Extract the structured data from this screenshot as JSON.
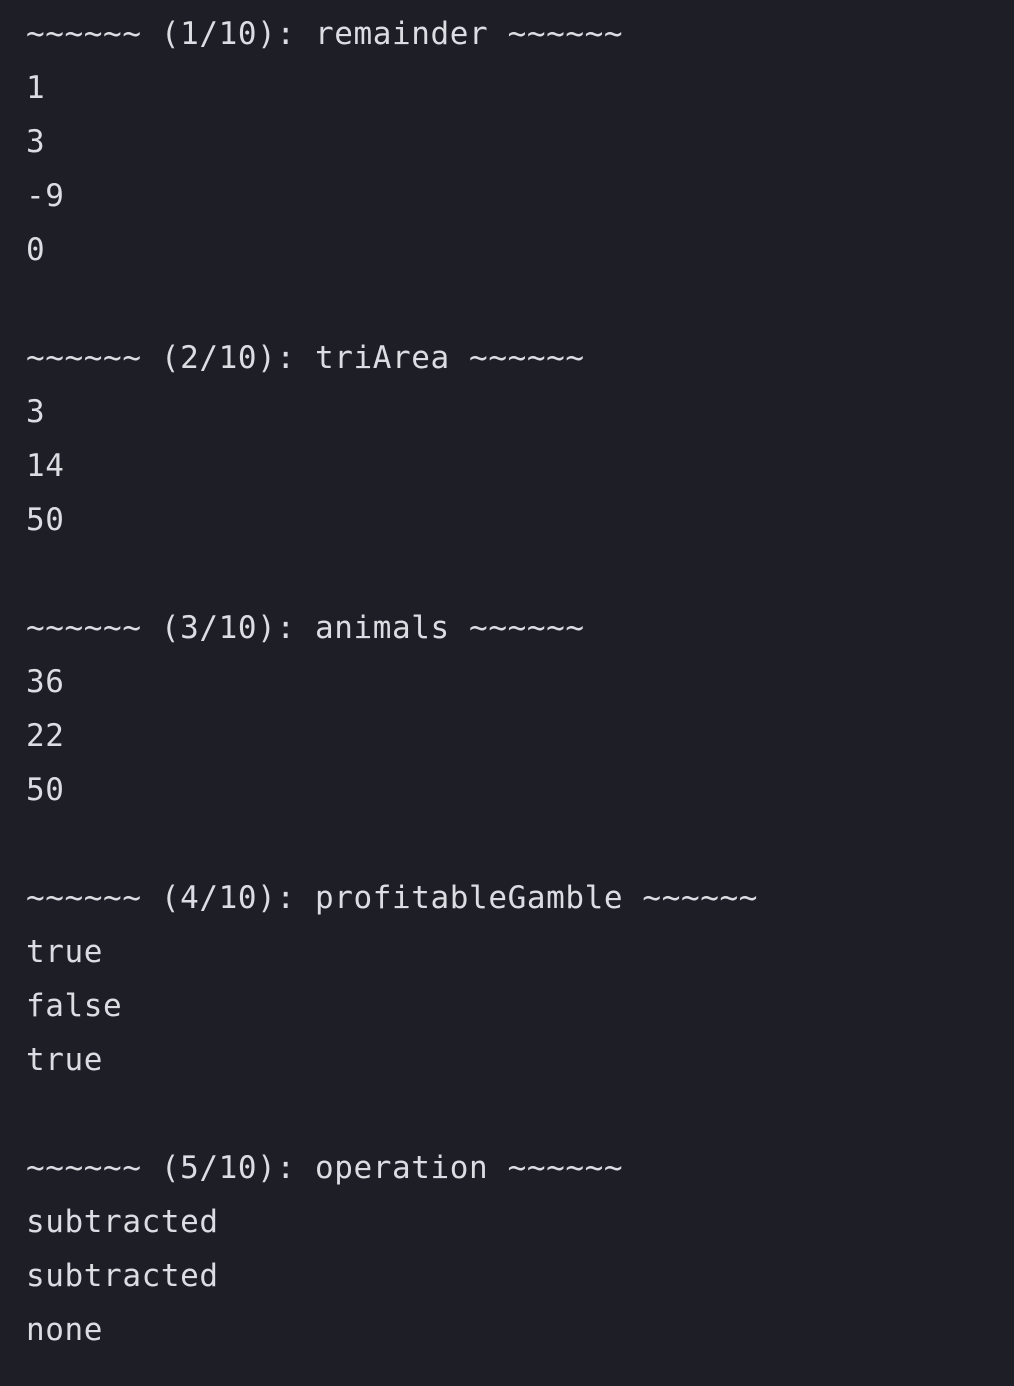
{
  "console": {
    "sections": [
      {
        "header": "~~~~~~ (1/10): remainder ~~~~~~",
        "lines": [
          "1",
          "3",
          "-9",
          "0"
        ]
      },
      {
        "header": "~~~~~~ (2/10): triArea ~~~~~~",
        "lines": [
          "3",
          "14",
          "50"
        ]
      },
      {
        "header": "~~~~~~ (3/10): animals ~~~~~~",
        "lines": [
          "36",
          "22",
          "50"
        ]
      },
      {
        "header": "~~~~~~ (4/10): profitableGamble ~~~~~~",
        "lines": [
          "true",
          "false",
          "true"
        ]
      },
      {
        "header": "~~~~~~ (5/10): operation ~~~~~~",
        "lines": [
          "subtracted",
          "subtracted",
          "none"
        ]
      }
    ]
  }
}
